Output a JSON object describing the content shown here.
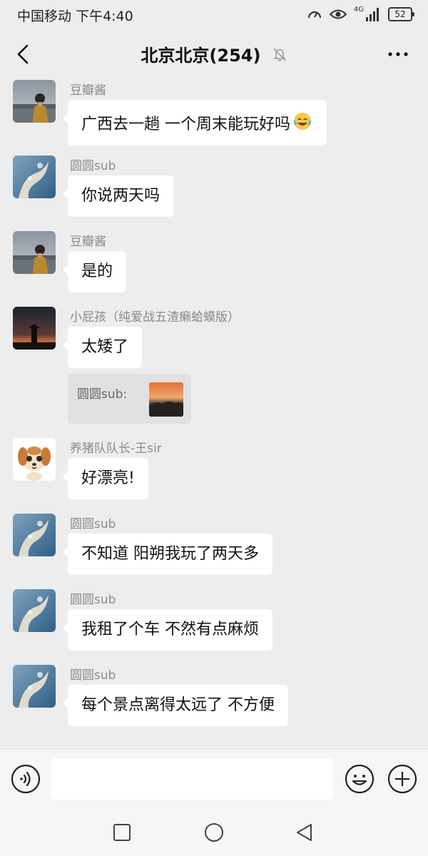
{
  "status_bar": {
    "carrier": "中国移动",
    "time": "下午4:40",
    "network": "4G",
    "battery": "52"
  },
  "header": {
    "title": "北京北京(254)"
  },
  "messages": [
    {
      "sender": "豆瓣酱",
      "text": "广西去一趟 一个周末能玩好吗",
      "avatar": "man-by-lake",
      "emoji": "grinning-squinting-face-with-tears"
    },
    {
      "sender": "圆圆sub",
      "text": "你说两天吗",
      "avatar": "water-splash"
    },
    {
      "sender": "豆瓣酱",
      "text": "是的",
      "avatar": "man-by-lake"
    },
    {
      "sender": "小屁孩（纯爱战五渣癞蛤蟆版）",
      "text": "太矮了",
      "avatar": "sunset-tower"
    },
    {
      "sender": "养猪队队长-王sir",
      "text": "好漂亮!",
      "avatar": "cartoon-dog"
    },
    {
      "sender": "圆圆sub",
      "text": "不知道 阳朔我玩了两天多",
      "avatar": "water-splash"
    },
    {
      "sender": "圆圆sub",
      "text": "我租了个车 不然有点麻烦",
      "avatar": "water-splash"
    },
    {
      "sender": "圆圆sub",
      "text": "每个景点离得太远了 不方便",
      "avatar": "water-splash"
    }
  ],
  "quote": {
    "text": "圆圆sub:",
    "thumb": "sunset-landscape"
  },
  "input": {
    "placeholder": ""
  },
  "icons": {
    "back": "chevron-left-icon",
    "mute": "bell-off-icon",
    "more": "ellipsis-icon",
    "voice": "voice-icon",
    "emoji": "smiley-icon",
    "plus": "plus-circle-icon",
    "nav": [
      "square-icon",
      "circle-icon",
      "triangle-left-icon"
    ]
  },
  "colors": {
    "background": "#ededed",
    "bubble": "#ffffff",
    "sender_name": "#8a8a8a",
    "bar": "#f6f6f6"
  }
}
